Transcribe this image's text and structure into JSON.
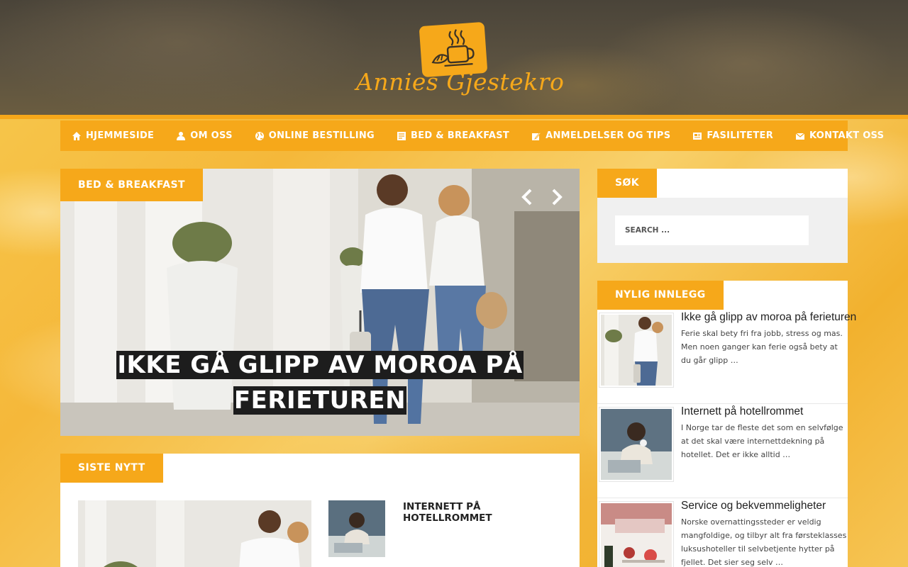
{
  "site": {
    "logo_text": "Annies Gjestekro",
    "accent_color": "#f6a81a"
  },
  "nav": {
    "items": [
      {
        "label": "HJEMMESIDE",
        "icon": "home-icon"
      },
      {
        "label": "OM OSS",
        "icon": "user-icon"
      },
      {
        "label": "ONLINE BESTILLING",
        "icon": "globe-icon"
      },
      {
        "label": "BED & BREAKFAST",
        "icon": "document-icon"
      },
      {
        "label": "ANMELDELSER OG TIPS",
        "icon": "edit-icon"
      },
      {
        "label": "FASILITETER",
        "icon": "newspaper-icon"
      },
      {
        "label": "KONTAKT OSS",
        "icon": "mail-icon"
      }
    ]
  },
  "slider": {
    "category": "BED & BREAKFAST",
    "title": "IKKE GÅ GLIPP AV MOROA PÅ FERIETUREN"
  },
  "latest": {
    "heading": "SISTE NYTT",
    "side_title": "INTERNETT PÅ HOTELLROMMET"
  },
  "search": {
    "heading": "SØK",
    "placeholder": "SEARCH ..."
  },
  "recent": {
    "heading": "NYLIG INNLEGG",
    "posts": [
      {
        "title": "Ikke gå glipp av moroa på ferieturen",
        "excerpt": "Ferie skal bety fri fra jobb, stress og mas. Men noen ganger kan ferie også bety at du går glipp …"
      },
      {
        "title": "Internett på hotellrommet",
        "excerpt": "I Norge tar de fleste det som en selvfølge at det skal være internettdekning på hotellet. Det er ikke alltid …"
      },
      {
        "title": "Service og bekvemmeligheter",
        "excerpt": "Norske overnattingssteder er veldig mangfoldige, og tilbyr alt fra førsteklasses luksushoteller til selvbetjente hytter på fjellet. Det sier seg selv …"
      }
    ]
  }
}
